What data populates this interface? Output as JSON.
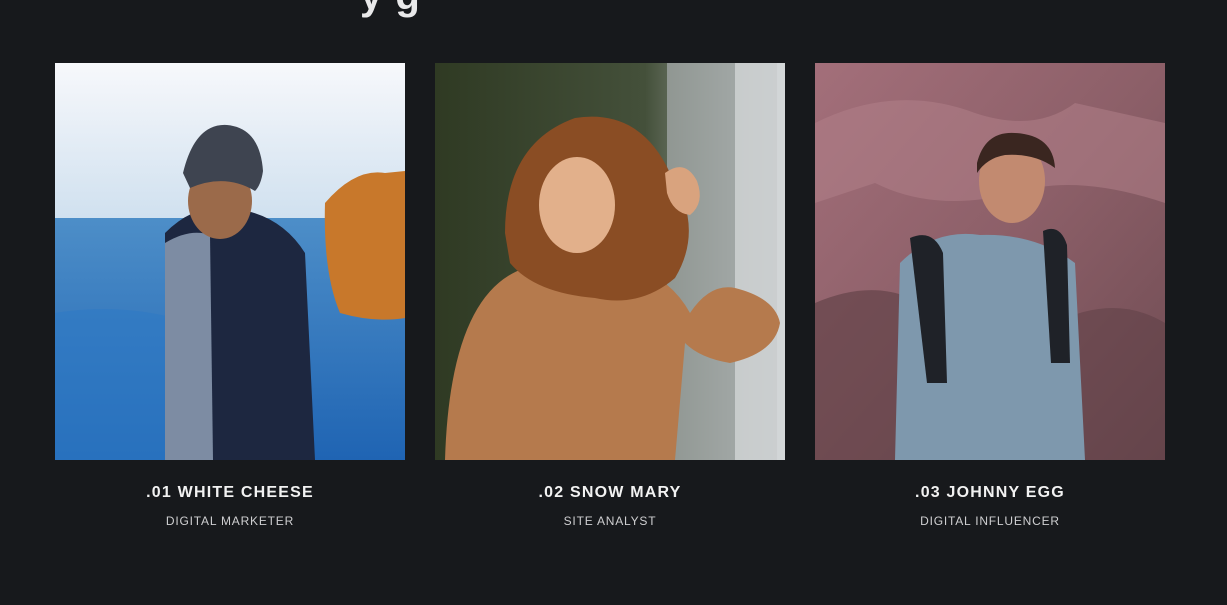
{
  "section": {
    "title_fragment": "y g"
  },
  "team": [
    {
      "name": ".01 WHITE CHEESE",
      "role": "DIGITAL MARKETER"
    },
    {
      "name": ".02 SNOW MARY",
      "role": "SITE ANALYST"
    },
    {
      "name": ".03 JOHNNY EGG",
      "role": "DIGITAL INFLUENCER"
    }
  ],
  "colors": {
    "background": "#17191c",
    "text": "#f2f2f2",
    "subtext": "#cfcfd1"
  }
}
